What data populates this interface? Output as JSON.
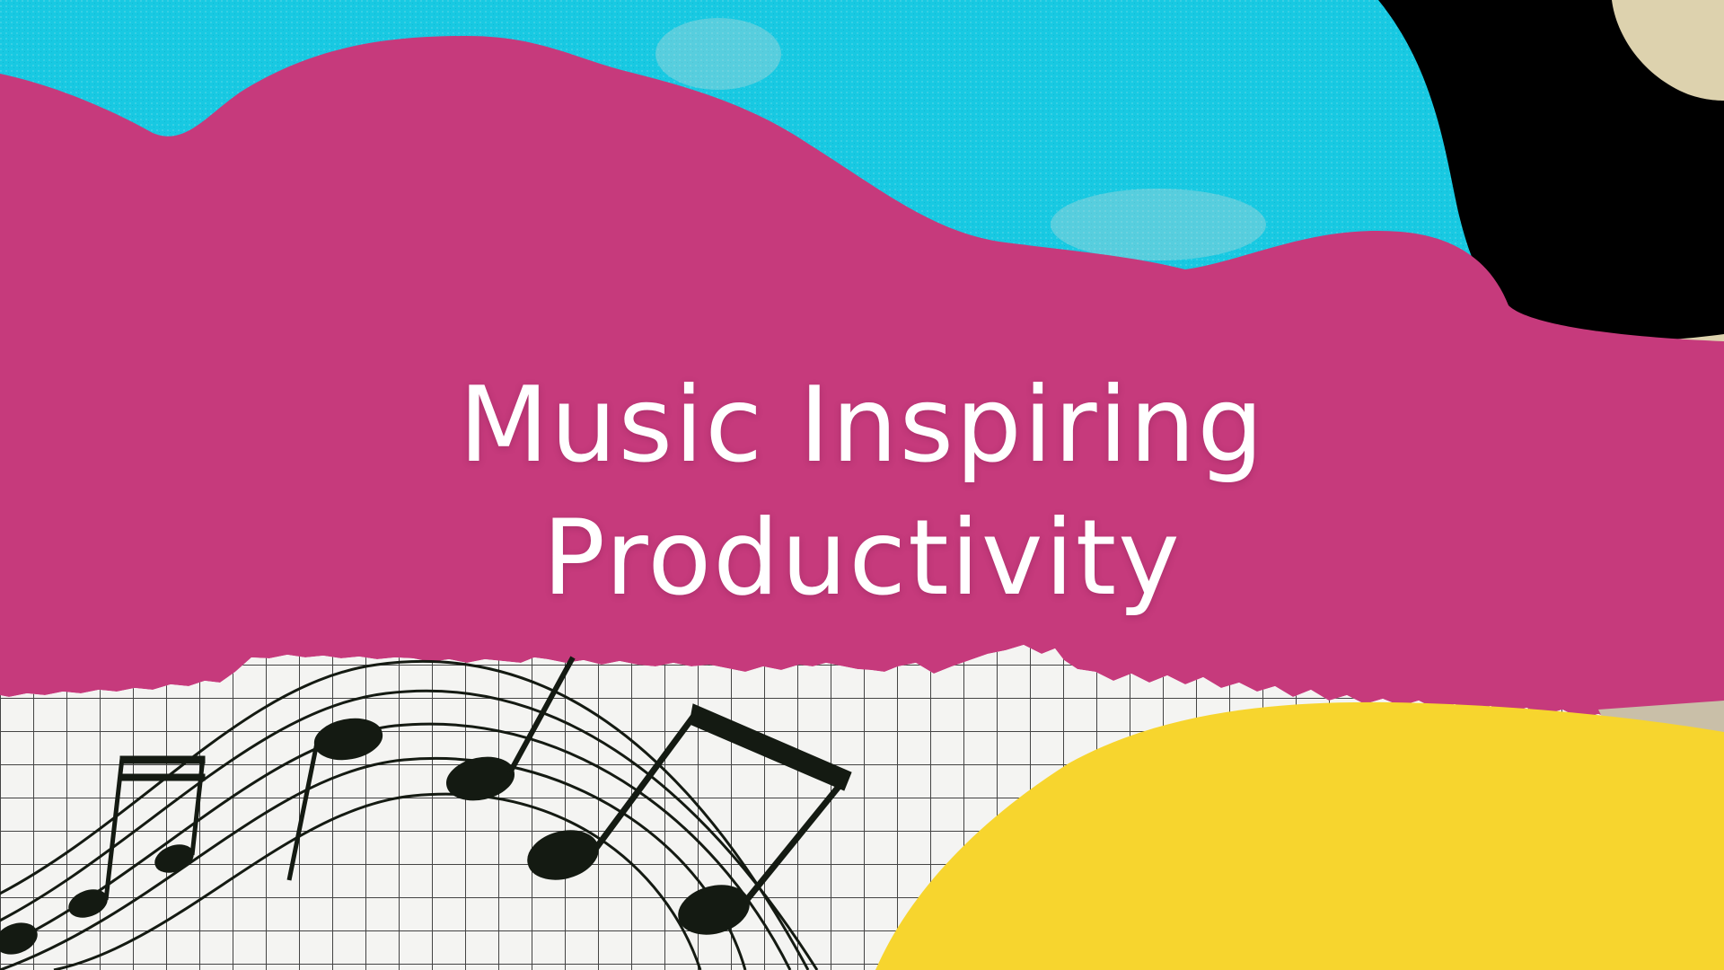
{
  "slide": {
    "title_line_1": "Music Inspiring",
    "title_line_2": "Productivity"
  },
  "palette": {
    "sky": "#16c8e0",
    "magenta": "#c63a7c",
    "black": "#000000",
    "cream": "#ddd2ae",
    "paper": "#f3f3f1",
    "grid": "#3a3a3a",
    "yellow": "#f7d52e",
    "note": "#141a12",
    "title_text": "#ffffff"
  },
  "decor": {
    "music_notes": "music-notes-icon",
    "grid_paper": "grid-paper-texture",
    "yellow_blob": "yellow-blob-shape"
  }
}
